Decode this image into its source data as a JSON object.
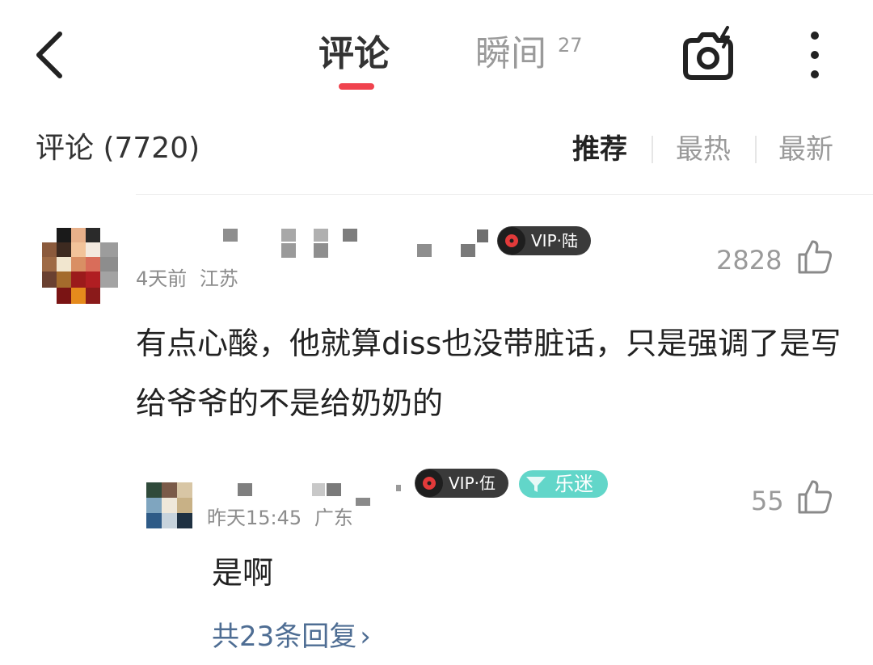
{
  "header": {
    "tabs": [
      {
        "label": "评论",
        "active": true
      },
      {
        "label": "瞬间",
        "badge": "27",
        "active": false
      }
    ],
    "icons": [
      "back-icon",
      "camera-icon",
      "more-icon"
    ],
    "accent_color": "#f0434e"
  },
  "comments_header": {
    "title": "评论 (7720)",
    "sort_options": [
      "推荐",
      "最热",
      "最新"
    ],
    "selected_sort": "推荐"
  },
  "comment": {
    "vip_label": "VIP·陆",
    "time": "4天前",
    "location": "江苏",
    "likes": "2828",
    "text": "有点心酸，他就算diss也没带脏话，只是强调了是写给爷爷的不是给奶奶的",
    "reply": {
      "vip_label": "VIP·伍",
      "fan_label": "乐迷",
      "time": "昨天15:45",
      "location": "广东",
      "likes": "55",
      "text": "是啊"
    },
    "replies_link": "共23条回复",
    "replies_chevron": "›"
  }
}
